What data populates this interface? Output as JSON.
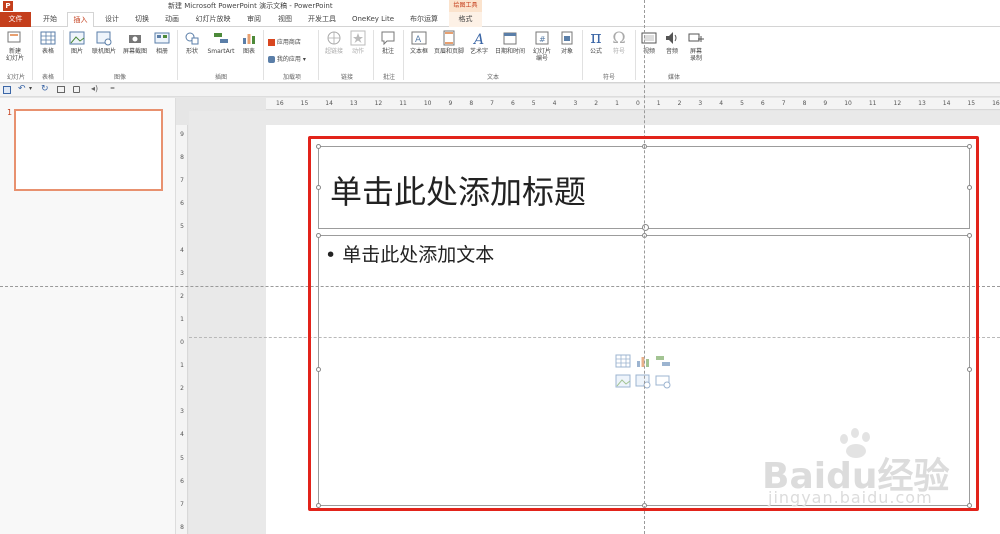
{
  "window": {
    "title": "新建 Microsoft PowerPoint 演示文稿 - PowerPoint",
    "context_tool_group": "绘图工具"
  },
  "tabs": [
    {
      "label": "文件"
    },
    {
      "label": "开始"
    },
    {
      "label": "插入"
    },
    {
      "label": "设计"
    },
    {
      "label": "切换"
    },
    {
      "label": "动画"
    },
    {
      "label": "幻灯片放映"
    },
    {
      "label": "审阅"
    },
    {
      "label": "视图"
    },
    {
      "label": "开发工具"
    },
    {
      "label": "OneKey Lite"
    },
    {
      "label": "布尔运算"
    },
    {
      "label": "格式"
    }
  ],
  "ribbon": {
    "new_slide": "新建\n幻灯片",
    "table": "表格",
    "picture": "图片",
    "online_picture": "联机图片",
    "screenshot": "屏幕截图",
    "album": "相册",
    "shapes": "形状",
    "smartart": "SmartArt",
    "chart": "图表",
    "app_store": "应用商店",
    "my_apps": "我的应用",
    "hyperlink": "超链接",
    "action": "动作",
    "comment": "批注",
    "textbox": "文本框",
    "header_footer": "页眉和页脚",
    "wordart": "艺术字",
    "datetime": "日期和时间",
    "slide_number": "幻灯片\n编号",
    "object": "对象",
    "equation": "公式",
    "symbol": "符号",
    "video": "视频",
    "audio": "音频",
    "screen_record": "屏幕\n录制",
    "groups": {
      "slides": "幻灯片",
      "tables": "表格",
      "images": "图像",
      "illustrations": "插图",
      "addins": "加载项",
      "links": "链接",
      "comments": "批注",
      "text": "文本",
      "symbols": "符号",
      "media": "媒体"
    }
  },
  "thumbnail": {
    "number": "1"
  },
  "slide": {
    "title_placeholder": "单击此处添加标题",
    "body_placeholder": "单击此处添加文本",
    "bullet": "•"
  },
  "ruler": {
    "h_labels": [
      "16",
      "15",
      "14",
      "13",
      "12",
      "11",
      "10",
      "9",
      "8",
      "7",
      "6",
      "5",
      "4",
      "3",
      "2",
      "1",
      "0",
      "1",
      "2",
      "3",
      "4",
      "5",
      "6",
      "7",
      "8",
      "9",
      "10",
      "11",
      "12",
      "13",
      "14",
      "15",
      "16"
    ],
    "v_labels": [
      "9",
      "8",
      "7",
      "6",
      "5",
      "4",
      "3",
      "2",
      "1",
      "0",
      "1",
      "2",
      "3",
      "4",
      "5",
      "6",
      "7",
      "8"
    ]
  },
  "watermark": {
    "brand": "Baidu经验",
    "url": "jingyan.baidu.com"
  },
  "colors": {
    "accent": "#c43e1c",
    "highlight_frame": "#e2231a",
    "thumb_border": "#e8916f"
  }
}
